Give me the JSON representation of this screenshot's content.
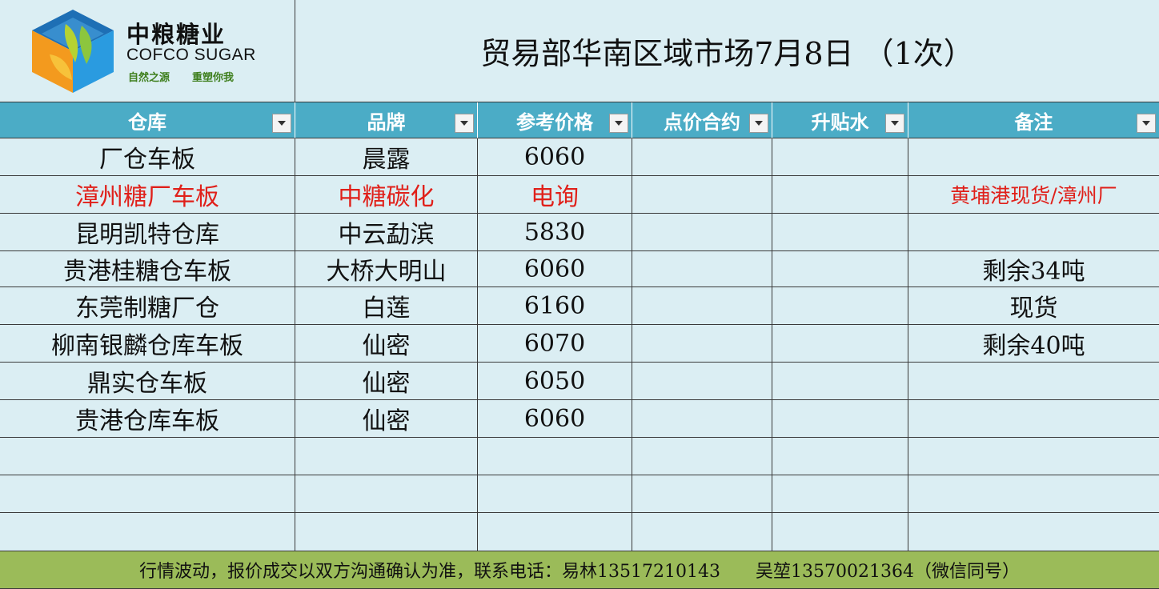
{
  "logo": {
    "name_cn": "中粮糖业",
    "name_en": "COFCO SUGAR",
    "slogan_left": "自然之源",
    "slogan_right": "重塑你我"
  },
  "title": "贸易部华南区域市场7月8日 （1次）",
  "columns": [
    {
      "label": "仓库"
    },
    {
      "label": "品牌"
    },
    {
      "label": "参考价格"
    },
    {
      "label": "点价合约"
    },
    {
      "label": "升贴水"
    },
    {
      "label": "备注"
    }
  ],
  "rows": [
    {
      "warehouse": "厂仓车板",
      "brand": "晨露",
      "price": "6060",
      "contract": "",
      "basis": "",
      "note": "",
      "highlight": false
    },
    {
      "warehouse": "漳州糖厂车板",
      "brand": "中糖碳化",
      "price": "电询",
      "contract": "",
      "basis": "",
      "note": "黄埔港现货/漳州厂",
      "highlight": true
    },
    {
      "warehouse": "昆明凯特仓库",
      "brand": "中云勐滨",
      "price": "5830",
      "contract": "",
      "basis": "",
      "note": "",
      "highlight": false
    },
    {
      "warehouse": "贵港桂糖仓车板",
      "brand": "大桥大明山",
      "price": "6060",
      "contract": "",
      "basis": "",
      "note": "剩余34吨",
      "highlight": false
    },
    {
      "warehouse": "东莞制糖厂仓",
      "brand": "白莲",
      "price": "6160",
      "contract": "",
      "basis": "",
      "note": "现货",
      "highlight": false
    },
    {
      "warehouse": "柳南银麟仓库车板",
      "brand": "仙密",
      "price": "6070",
      "contract": "",
      "basis": "",
      "note": "剩余40吨",
      "highlight": false
    },
    {
      "warehouse": "鼎实仓车板",
      "brand": "仙密",
      "price": "6050",
      "contract": "",
      "basis": "",
      "note": "",
      "highlight": false
    },
    {
      "warehouse": "贵港仓库车板",
      "brand": "仙密",
      "price": "6060",
      "contract": "",
      "basis": "",
      "note": "",
      "highlight": false
    },
    {
      "warehouse": "",
      "brand": "",
      "price": "",
      "contract": "",
      "basis": "",
      "note": "",
      "highlight": false
    },
    {
      "warehouse": "",
      "brand": "",
      "price": "",
      "contract": "",
      "basis": "",
      "note": "",
      "highlight": false
    },
    {
      "warehouse": "",
      "brand": "",
      "price": "",
      "contract": "",
      "basis": "",
      "note": "",
      "highlight": false
    }
  ],
  "footer": "行情波动，报价成交以双方沟通确认为准，联系电话：易林13517210143　　吴堃13570021364（微信同号）",
  "colors": {
    "header_bg": "#4bacc6",
    "body_bg": "#dbeef3",
    "footer_bg": "#9bbb59",
    "highlight_text": "#e0201a"
  }
}
